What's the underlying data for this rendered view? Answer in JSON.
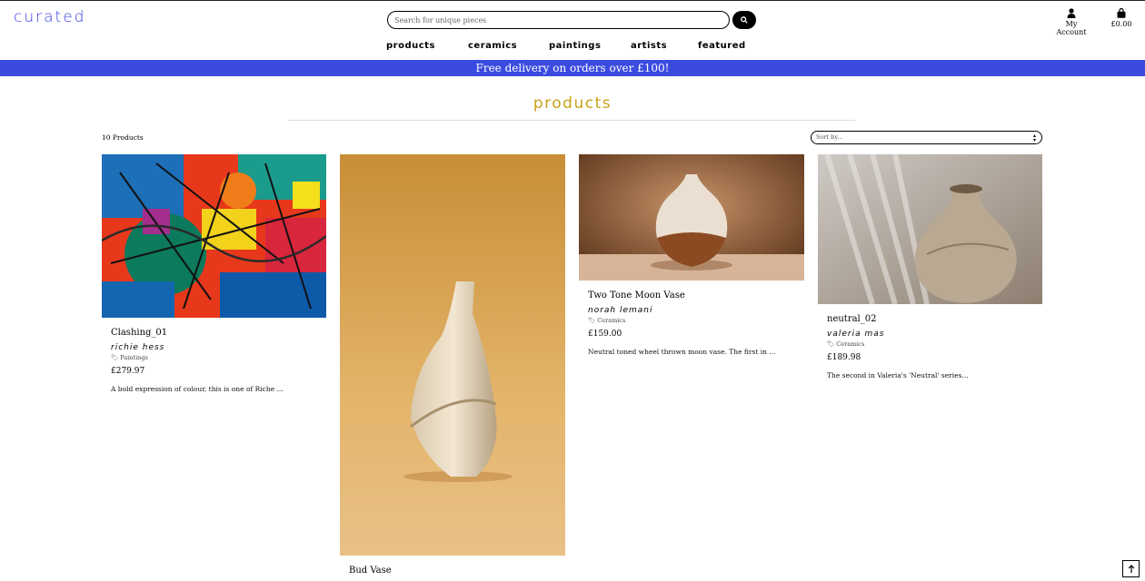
{
  "brand": {
    "logo": "curated",
    "accent": "#3b3fe0"
  },
  "search": {
    "placeholder": "Search for unique pieces"
  },
  "header": {
    "account_label": "My Account",
    "basket_total": "£0.00"
  },
  "nav": [
    "products",
    "ceramics",
    "paintings",
    "artists",
    "featured"
  ],
  "banner": {
    "text": "Free delivery on orders over £100!",
    "color": "#3b4be0"
  },
  "page": {
    "title": "products",
    "title_color": "#c9a21a",
    "count": "10 Products",
    "sort_placeholder": "Sort by..."
  },
  "products": [
    {
      "name": "Clashing_01",
      "artist": "Richie Hess",
      "category": "Paintings",
      "price": "£279.97",
      "description": "A bold expression of colour, this is one of Riche ..."
    },
    {
      "name": "Bud Vase",
      "artist": "",
      "category": "",
      "price": "",
      "description": ""
    },
    {
      "name": "Two Tone Moon Vase",
      "artist": "Norah Lemani",
      "category": "Ceramics",
      "price": "£159.00",
      "description": "Neutral toned wheel thrown moon vase. The first in ..."
    },
    {
      "name": "neutral_02",
      "artist": "Valeria Mas",
      "category": "Ceramics",
      "price": "£189.98",
      "description": "The second in Valeria's 'Neutral' series..."
    }
  ]
}
